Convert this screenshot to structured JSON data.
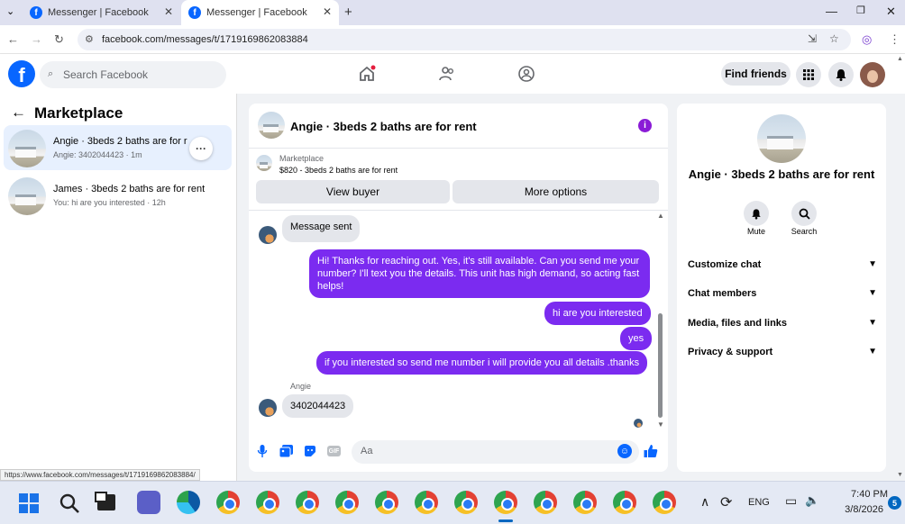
{
  "browser": {
    "tabs": [
      {
        "title": "Messenger | Facebook"
      },
      {
        "title": "Messenger | Facebook"
      }
    ],
    "url": "facebook.com/messages/t/1719169862083884",
    "status_url": "https://www.facebook.com/messages/t/1719169862083884/"
  },
  "facebook": {
    "search_placeholder": "Search Facebook",
    "find_friends": "Find friends"
  },
  "left": {
    "title": "Marketplace",
    "conversations": [
      {
        "name": "Angie · 3beds 2 baths are for r",
        "preview": "Angie: 3402044423 · 1m"
      },
      {
        "name": "James · 3beds 2 baths are for rent",
        "preview": "You: hi are you interested · 12h"
      }
    ]
  },
  "chat": {
    "title": "Angie · 3beds 2 baths are for rent",
    "listing_source": "Marketplace",
    "listing_price": "$820 - 3beds 2 baths are for rent",
    "view_buyer": "View buyer",
    "more_options": "More options",
    "messages": [
      {
        "from": "in",
        "text": "Message sent"
      },
      {
        "from": "out",
        "text": "Hi! Thanks for reaching out. Yes, it's still available. Can you send me your number? I'll text you the details. This unit has high demand, so acting fast helps!"
      },
      {
        "from": "out",
        "text": "hi are you interested"
      },
      {
        "from": "out",
        "text": "yes"
      },
      {
        "from": "out",
        "text": "if you interested so send me number i will provide you all details .thanks"
      },
      {
        "from": "in",
        "sender": "Angie",
        "text": "3402044423"
      }
    ],
    "composer_placeholder": "Aa"
  },
  "right": {
    "title": "Angie · 3beds 2 baths are for rent",
    "actions": [
      {
        "label": "Mute"
      },
      {
        "label": "Search"
      }
    ],
    "sections": [
      "Customize chat",
      "Chat members",
      "Media, files and links",
      "Privacy & support"
    ]
  },
  "taskbar": {
    "lang": "ENG",
    "time": "7:40 PM",
    "date": "3/8/2026",
    "badge": "5"
  },
  "colors": {
    "fb_blue": "#0866ff",
    "outgoing_bubble": "#7b2bf0",
    "selected_row": "#e7f0fe"
  }
}
